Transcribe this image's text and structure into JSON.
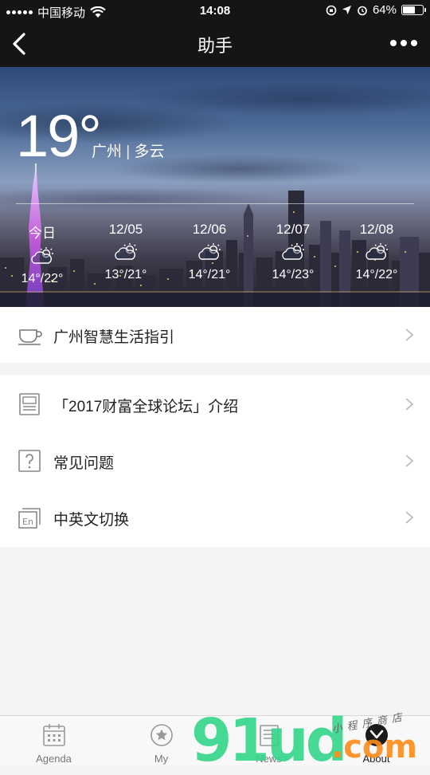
{
  "status": {
    "carrier": "中国移动",
    "time": "14:08",
    "battery": "64%",
    "battery_level": 0.64,
    "icons": [
      "signal-dots",
      "wifi-icon",
      "orientation-lock-icon",
      "location-arrow-icon",
      "alarm-icon",
      "battery-icon"
    ]
  },
  "nav": {
    "title": "助手",
    "back_icon": "chevron-left-icon",
    "more_icon": "more-dots-icon"
  },
  "weather": {
    "current_temp": "19°",
    "city": "广州",
    "separator": "|",
    "condition": "多云",
    "forecast": [
      {
        "day": "今日",
        "temp": "14°/22°",
        "icon": "partly-cloudy-icon"
      },
      {
        "day": "12/05",
        "temp": "13°/21°",
        "icon": "partly-cloudy-icon"
      },
      {
        "day": "12/06",
        "temp": "14°/21°",
        "icon": "partly-cloudy-icon"
      },
      {
        "day": "12/07",
        "temp": "14°/23°",
        "icon": "partly-cloudy-icon"
      },
      {
        "day": "12/08",
        "temp": "14°/22°",
        "icon": "partly-cloudy-icon"
      }
    ]
  },
  "menu": {
    "guide": {
      "label": "广州智慧生活指引",
      "icon": "cup-icon"
    },
    "items": [
      {
        "label": "「2017财富全球论坛」介绍",
        "icon": "document-icon"
      },
      {
        "label": "常见问题",
        "icon": "question-icon"
      },
      {
        "label": "中英文切换",
        "icon": "language-en-icon"
      }
    ]
  },
  "tabs": [
    {
      "label": "Agenda",
      "icon": "calendar-icon"
    },
    {
      "label": "My",
      "icon": "star-circle-icon"
    },
    {
      "label": "News",
      "icon": "news-icon"
    },
    {
      "label": "About",
      "icon": "about-icon",
      "active": true
    }
  ],
  "watermark": {
    "main": "91ud",
    "suffix": ".com",
    "tagline": "小程序商店"
  },
  "colors": {
    "topbar": "#151515",
    "background": "#f4f4f4",
    "watermark_green": "#33d68a",
    "watermark_orange": "#ff8c1a"
  }
}
